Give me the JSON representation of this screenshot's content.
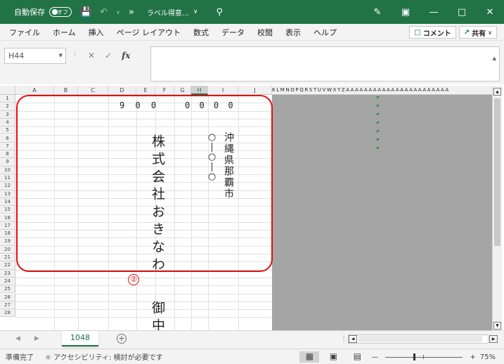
{
  "titlebar": {
    "autosave_label": "自動保存",
    "autosave_state": "オフ",
    "file_name": "ラベル得意…",
    "more": "»"
  },
  "menu": {
    "items": [
      "ファイル",
      "ホーム",
      "挿入",
      "ページ レイアウト",
      "数式",
      "データ",
      "校閲",
      "表示",
      "ヘルプ"
    ],
    "comment_label": "コメント",
    "share_label": "共有"
  },
  "formula_bar": {
    "name_box": "H44",
    "fx_label": "fx",
    "value": ""
  },
  "columns": [
    "A",
    "B",
    "C",
    "D",
    "E",
    "F",
    "G",
    "H",
    "I",
    "J"
  ],
  "selected_column": "H",
  "gray_columns": "K L M N O P Q R S T U V W X Y Z A A A A A A A A A A A A A A A A A A A A A A A",
  "rows": [
    "1",
    "2",
    "3",
    "4",
    "5",
    "6",
    "7",
    "8",
    "9",
    "10",
    "11",
    "12",
    "13",
    "14",
    "15",
    "16",
    "17",
    "18",
    "19",
    "20",
    "21",
    "22",
    "23",
    "24",
    "25",
    "26",
    "27",
    "28"
  ],
  "cells": {
    "postal_prefix": "9 0 0",
    "postal_suffix": "0 0 0 0",
    "company_name": "株式会社おきなわ",
    "honorific": "御中",
    "address": "沖縄県那覇市",
    "address_num": "○―○―○"
  },
  "annotation": {
    "marker": "②",
    "color": "#e01010"
  },
  "sheets": {
    "active": "1048"
  },
  "status": {
    "ready": "準備完了",
    "accessibility": "アクセシビリティ: 検討が必要です",
    "zoom": "75%"
  },
  "colors": {
    "excel_green": "#217346",
    "highlight_red": "#e01010"
  }
}
